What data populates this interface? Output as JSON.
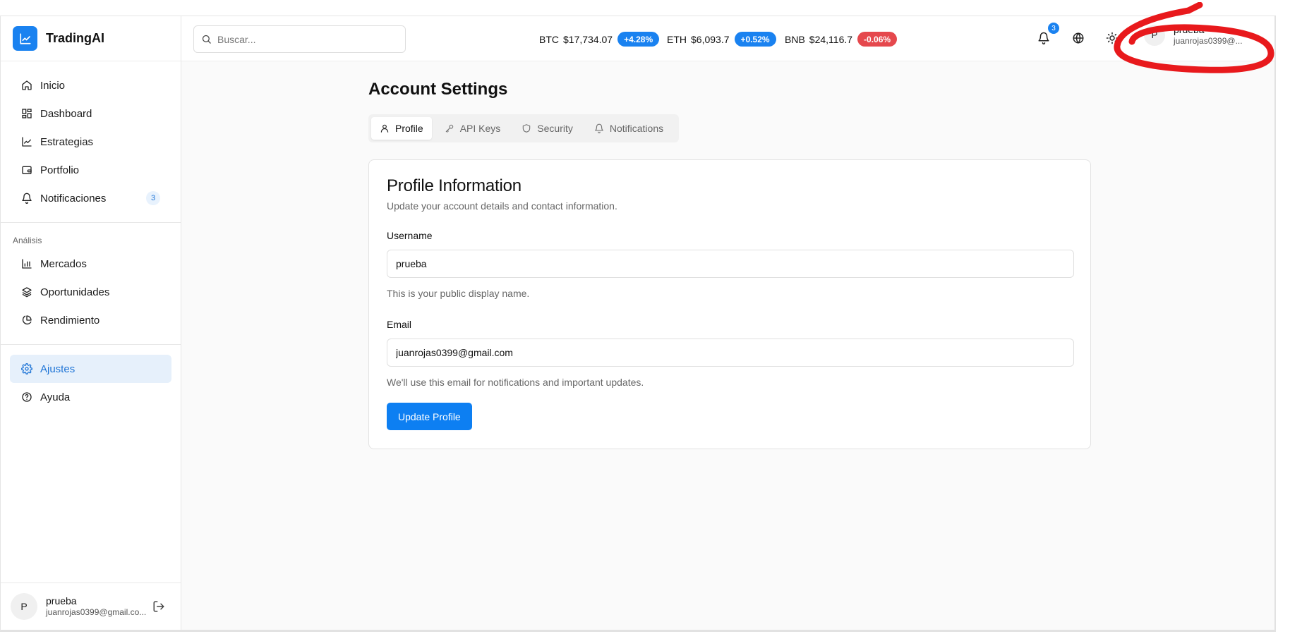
{
  "brand": {
    "name": "TradingAI"
  },
  "sidebar": {
    "items": [
      {
        "label": "Inicio",
        "icon": "home-icon"
      },
      {
        "label": "Dashboard",
        "icon": "grid-icon"
      },
      {
        "label": "Estrategias",
        "icon": "chart-line-icon"
      },
      {
        "label": "Portfolio",
        "icon": "wallet-icon"
      },
      {
        "label": "Notificaciones",
        "icon": "bell-icon",
        "badge": "3"
      }
    ],
    "analysis_label": "Análisis",
    "analysis_items": [
      {
        "label": "Mercados",
        "icon": "bar-chart-icon"
      },
      {
        "label": "Oportunidades",
        "icon": "layers-icon"
      },
      {
        "label": "Rendimiento",
        "icon": "pie-chart-icon"
      }
    ],
    "bottom_items": [
      {
        "label": "Ajustes",
        "icon": "gear-icon",
        "active": true
      },
      {
        "label": "Ayuda",
        "icon": "help-icon"
      }
    ],
    "user": {
      "avatar": "P",
      "name": "prueba",
      "email": "juanrojas0399@gmail.co..."
    }
  },
  "topbar": {
    "search_placeholder": "Buscar...",
    "tickers": [
      {
        "symbol": "BTC",
        "price": "$17,734.07",
        "change": "+4.28%",
        "color": "#1a82f0"
      },
      {
        "symbol": "ETH",
        "price": "$6,093.7",
        "change": "+0.52%",
        "color": "#1a82f0"
      },
      {
        "symbol": "BNB",
        "price": "$24,116.7",
        "change": "-0.06%",
        "color": "#e5484d"
      }
    ],
    "notification_count": "3",
    "user": {
      "avatar": "P",
      "name": "prueba",
      "email": "juanrojas0399@..."
    }
  },
  "page": {
    "title": "Account Settings",
    "tabs": [
      {
        "label": "Profile",
        "icon": "user-icon",
        "active": true
      },
      {
        "label": "API Keys",
        "icon": "key-icon"
      },
      {
        "label": "Security",
        "icon": "shield-icon"
      },
      {
        "label": "Notifications",
        "icon": "bell-icon"
      }
    ],
    "card": {
      "title": "Profile Information",
      "subtitle": "Update your account details and contact information.",
      "username_label": "Username",
      "username_value": "prueba",
      "username_hint": "This is your public display name.",
      "email_label": "Email",
      "email_value": "juanrojas0399@gmail.com",
      "email_hint": "We'll use this email for notifications and important updates.",
      "submit_label": "Update Profile"
    }
  },
  "colors": {
    "accent": "#1a82f0",
    "negative": "#e5484d",
    "annotation": "#e8191c"
  }
}
